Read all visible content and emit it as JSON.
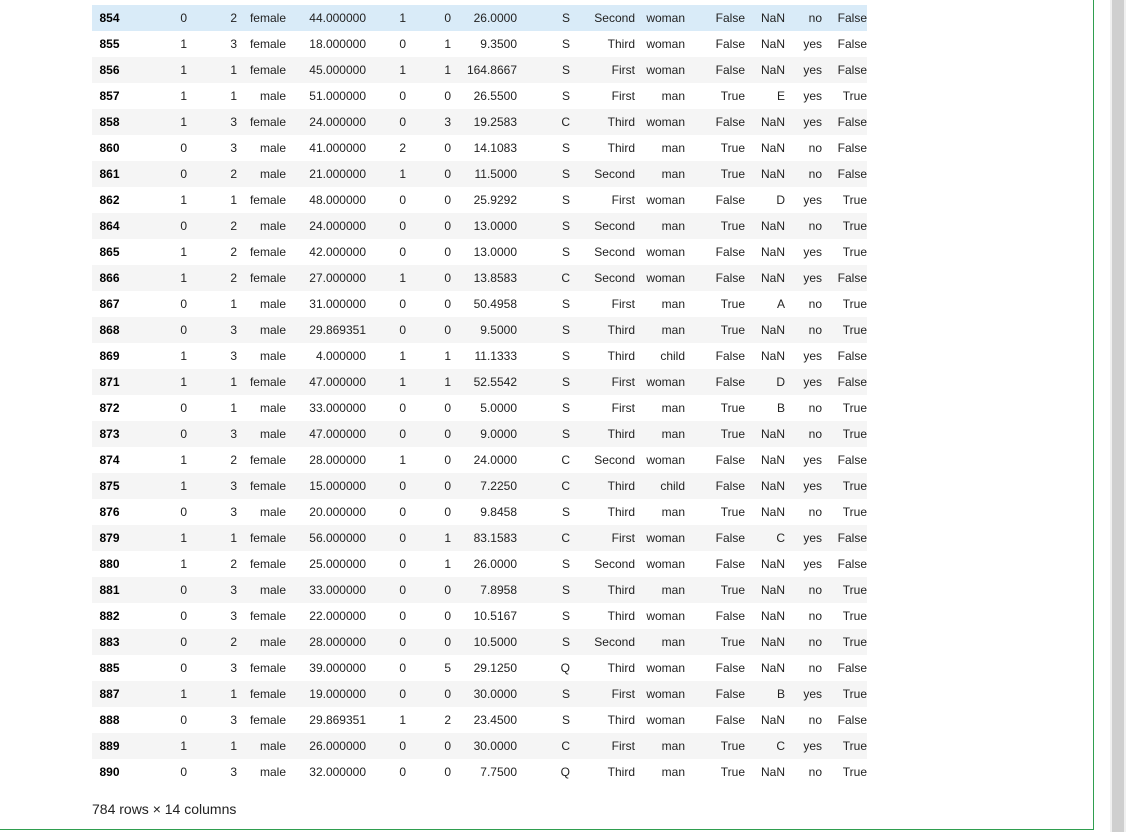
{
  "table": {
    "hover_row_index": 0,
    "rows": [
      [
        "854",
        "0",
        "2",
        "female",
        "44.000000",
        "1",
        "0",
        "26.0000",
        "S",
        "Second",
        "woman",
        "False",
        "NaN",
        "no",
        "False"
      ],
      [
        "855",
        "1",
        "3",
        "female",
        "18.000000",
        "0",
        "1",
        "9.3500",
        "S",
        "Third",
        "woman",
        "False",
        "NaN",
        "yes",
        "False"
      ],
      [
        "856",
        "1",
        "1",
        "female",
        "45.000000",
        "1",
        "1",
        "164.8667",
        "S",
        "First",
        "woman",
        "False",
        "NaN",
        "yes",
        "False"
      ],
      [
        "857",
        "1",
        "1",
        "male",
        "51.000000",
        "0",
        "0",
        "26.5500",
        "S",
        "First",
        "man",
        "True",
        "E",
        "yes",
        "True"
      ],
      [
        "858",
        "1",
        "3",
        "female",
        "24.000000",
        "0",
        "3",
        "19.2583",
        "C",
        "Third",
        "woman",
        "False",
        "NaN",
        "yes",
        "False"
      ],
      [
        "860",
        "0",
        "3",
        "male",
        "41.000000",
        "2",
        "0",
        "14.1083",
        "S",
        "Third",
        "man",
        "True",
        "NaN",
        "no",
        "False"
      ],
      [
        "861",
        "0",
        "2",
        "male",
        "21.000000",
        "1",
        "0",
        "11.5000",
        "S",
        "Second",
        "man",
        "True",
        "NaN",
        "no",
        "False"
      ],
      [
        "862",
        "1",
        "1",
        "female",
        "48.000000",
        "0",
        "0",
        "25.9292",
        "S",
        "First",
        "woman",
        "False",
        "D",
        "yes",
        "True"
      ],
      [
        "864",
        "0",
        "2",
        "male",
        "24.000000",
        "0",
        "0",
        "13.0000",
        "S",
        "Second",
        "man",
        "True",
        "NaN",
        "no",
        "True"
      ],
      [
        "865",
        "1",
        "2",
        "female",
        "42.000000",
        "0",
        "0",
        "13.0000",
        "S",
        "Second",
        "woman",
        "False",
        "NaN",
        "yes",
        "True"
      ],
      [
        "866",
        "1",
        "2",
        "female",
        "27.000000",
        "1",
        "0",
        "13.8583",
        "C",
        "Second",
        "woman",
        "False",
        "NaN",
        "yes",
        "False"
      ],
      [
        "867",
        "0",
        "1",
        "male",
        "31.000000",
        "0",
        "0",
        "50.4958",
        "S",
        "First",
        "man",
        "True",
        "A",
        "no",
        "True"
      ],
      [
        "868",
        "0",
        "3",
        "male",
        "29.869351",
        "0",
        "0",
        "9.5000",
        "S",
        "Third",
        "man",
        "True",
        "NaN",
        "no",
        "True"
      ],
      [
        "869",
        "1",
        "3",
        "male",
        "4.000000",
        "1",
        "1",
        "11.1333",
        "S",
        "Third",
        "child",
        "False",
        "NaN",
        "yes",
        "False"
      ],
      [
        "871",
        "1",
        "1",
        "female",
        "47.000000",
        "1",
        "1",
        "52.5542",
        "S",
        "First",
        "woman",
        "False",
        "D",
        "yes",
        "False"
      ],
      [
        "872",
        "0",
        "1",
        "male",
        "33.000000",
        "0",
        "0",
        "5.0000",
        "S",
        "First",
        "man",
        "True",
        "B",
        "no",
        "True"
      ],
      [
        "873",
        "0",
        "3",
        "male",
        "47.000000",
        "0",
        "0",
        "9.0000",
        "S",
        "Third",
        "man",
        "True",
        "NaN",
        "no",
        "True"
      ],
      [
        "874",
        "1",
        "2",
        "female",
        "28.000000",
        "1",
        "0",
        "24.0000",
        "C",
        "Second",
        "woman",
        "False",
        "NaN",
        "yes",
        "False"
      ],
      [
        "875",
        "1",
        "3",
        "female",
        "15.000000",
        "0",
        "0",
        "7.2250",
        "C",
        "Third",
        "child",
        "False",
        "NaN",
        "yes",
        "True"
      ],
      [
        "876",
        "0",
        "3",
        "male",
        "20.000000",
        "0",
        "0",
        "9.8458",
        "S",
        "Third",
        "man",
        "True",
        "NaN",
        "no",
        "True"
      ],
      [
        "879",
        "1",
        "1",
        "female",
        "56.000000",
        "0",
        "1",
        "83.1583",
        "C",
        "First",
        "woman",
        "False",
        "C",
        "yes",
        "False"
      ],
      [
        "880",
        "1",
        "2",
        "female",
        "25.000000",
        "0",
        "1",
        "26.0000",
        "S",
        "Second",
        "woman",
        "False",
        "NaN",
        "yes",
        "False"
      ],
      [
        "881",
        "0",
        "3",
        "male",
        "33.000000",
        "0",
        "0",
        "7.8958",
        "S",
        "Third",
        "man",
        "True",
        "NaN",
        "no",
        "True"
      ],
      [
        "882",
        "0",
        "3",
        "female",
        "22.000000",
        "0",
        "0",
        "10.5167",
        "S",
        "Third",
        "woman",
        "False",
        "NaN",
        "no",
        "True"
      ],
      [
        "883",
        "0",
        "2",
        "male",
        "28.000000",
        "0",
        "0",
        "10.5000",
        "S",
        "Second",
        "man",
        "True",
        "NaN",
        "no",
        "True"
      ],
      [
        "885",
        "0",
        "3",
        "female",
        "39.000000",
        "0",
        "5",
        "29.1250",
        "Q",
        "Third",
        "woman",
        "False",
        "NaN",
        "no",
        "False"
      ],
      [
        "887",
        "1",
        "1",
        "female",
        "19.000000",
        "0",
        "0",
        "30.0000",
        "S",
        "First",
        "woman",
        "False",
        "B",
        "yes",
        "True"
      ],
      [
        "888",
        "0",
        "3",
        "female",
        "29.869351",
        "1",
        "2",
        "23.4500",
        "S",
        "Third",
        "woman",
        "False",
        "NaN",
        "no",
        "False"
      ],
      [
        "889",
        "1",
        "1",
        "male",
        "26.000000",
        "0",
        "0",
        "30.0000",
        "C",
        "First",
        "man",
        "True",
        "C",
        "yes",
        "True"
      ],
      [
        "890",
        "0",
        "3",
        "male",
        "32.000000",
        "0",
        "0",
        "7.7500",
        "Q",
        "Third",
        "man",
        "True",
        "NaN",
        "no",
        "True"
      ]
    ]
  },
  "footer": {
    "shape_text": "784 rows × 14 columns"
  },
  "colors": {
    "cell_border": "#2f9e4f",
    "hover_row": "#d9ebf8",
    "stripe": "#f5f5f5"
  }
}
